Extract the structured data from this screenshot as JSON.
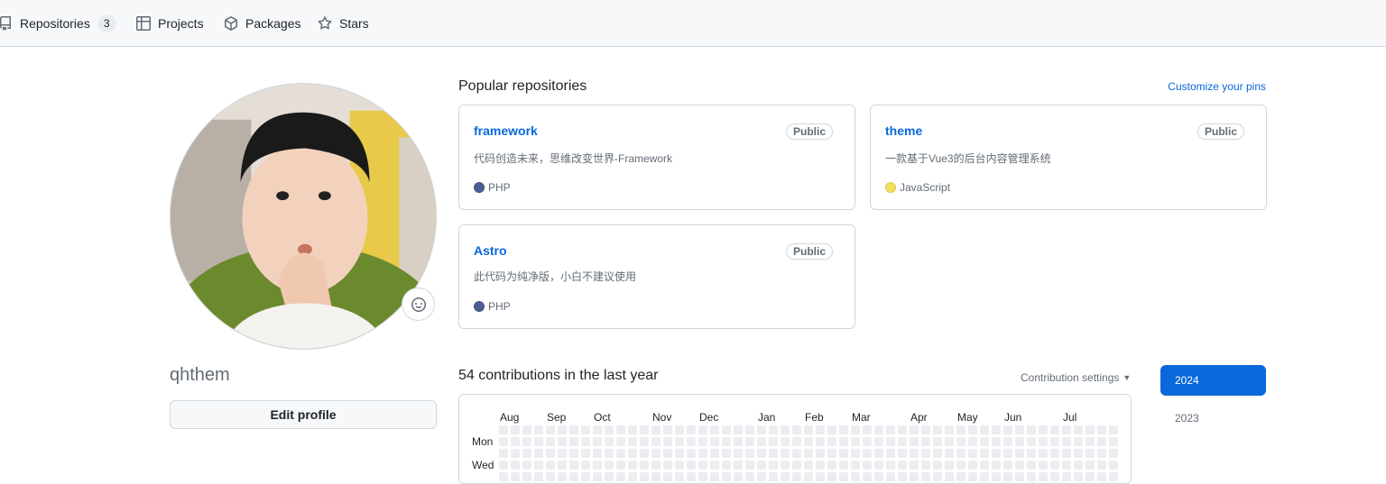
{
  "nav": {
    "items": [
      {
        "label": "Repositories",
        "icon": "repo-icon",
        "count": "3"
      },
      {
        "label": "Projects",
        "icon": "table-icon"
      },
      {
        "label": "Packages",
        "icon": "package-icon"
      },
      {
        "label": "Stars",
        "icon": "star-icon"
      }
    ]
  },
  "profile": {
    "username": "qhthem",
    "edit_label": "Edit profile",
    "status_icon": "smiley-icon"
  },
  "popular": {
    "title": "Popular repositories",
    "customize": "Customize your pins",
    "repos": [
      {
        "name": "framework",
        "visibility": "Public",
        "description": "代码创造未来，思维改变世界-Framework",
        "language": "PHP",
        "lang_color": "#4F5D95"
      },
      {
        "name": "theme",
        "visibility": "Public",
        "description": "一款基于Vue3的后台内容管理系统",
        "language": "JavaScript",
        "lang_color": "#f1e05a"
      },
      {
        "name": "Astro",
        "visibility": "Public",
        "description": "此代码为纯净版，小白不建议使用",
        "language": "PHP",
        "lang_color": "#4F5D95"
      }
    ]
  },
  "contributions": {
    "title": "54 contributions in the last year",
    "settings": "Contribution settings",
    "months": [
      "Aug",
      "Sep",
      "Oct",
      "Nov",
      "Dec",
      "Jan",
      "Feb",
      "Mar",
      "Apr",
      "May",
      "Jun",
      "Jul"
    ],
    "days": [
      "Mon",
      "Wed"
    ],
    "years": [
      "2024",
      "2023"
    ]
  }
}
